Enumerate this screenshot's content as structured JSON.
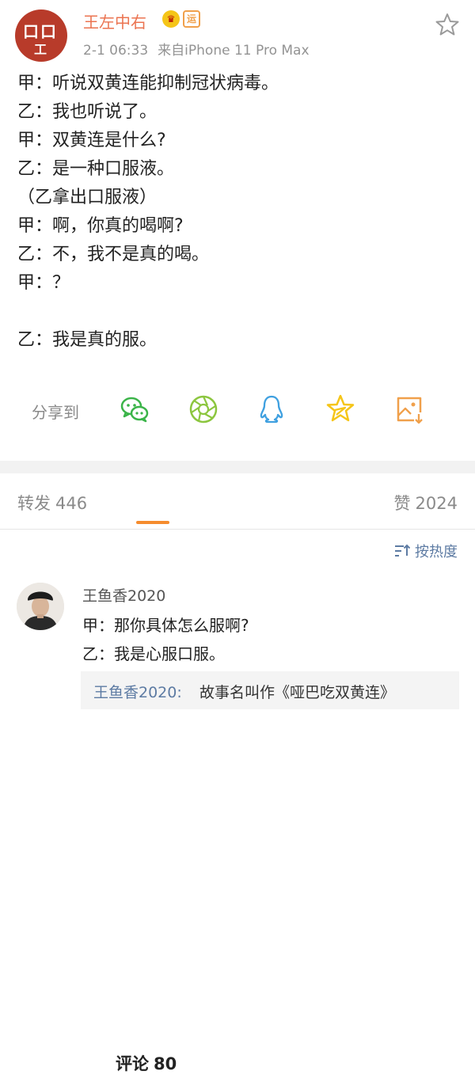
{
  "header": {
    "username": "王左中右",
    "avatar_text_top": "口口",
    "avatar_text_bottom": "工",
    "badge_crown": "♛",
    "badge_yun": "运",
    "time": "2-1 06:33",
    "source": "来自iPhone 11 Pro Max"
  },
  "post": {
    "lines": [
      "甲：听说双黄连能抑制冠状病毒。",
      "乙：我也听说了。",
      "甲：双黄连是什么?",
      "乙：是一种口服液。",
      "（乙拿出口服液）",
      "甲：啊，你真的喝啊?",
      "乙：不，我不是真的喝。",
      "甲：？",
      "",
      "乙：我是真的服。"
    ]
  },
  "share": {
    "label": "分享到",
    "targets": [
      "wechat-icon",
      "moments-icon",
      "qq-icon",
      "qzone-icon",
      "save-image-icon"
    ]
  },
  "tabs": {
    "repost_label": "转发",
    "repost_count": "446",
    "comment_label": "评论",
    "comment_count": "80",
    "like_label": "赞",
    "like_count": "2024"
  },
  "sort": {
    "label": "按热度"
  },
  "comment": {
    "user": "王鱼香2020",
    "line1": "甲：那你具体怎么服啊?",
    "line2": "乙：我是心服口服。",
    "reply_author": "王鱼香2020:",
    "reply_text": "故事名叫作《哑巴吃双黄连》"
  },
  "colors": {
    "username": "#eb7350",
    "accent_underline": "#f58c2e",
    "link": "#5d7ba3",
    "wechat": "#3bb449",
    "moments": "#8cc63f",
    "qq": "#3fa0e0",
    "qzone": "#f5c518",
    "save": "#f0a04b"
  }
}
